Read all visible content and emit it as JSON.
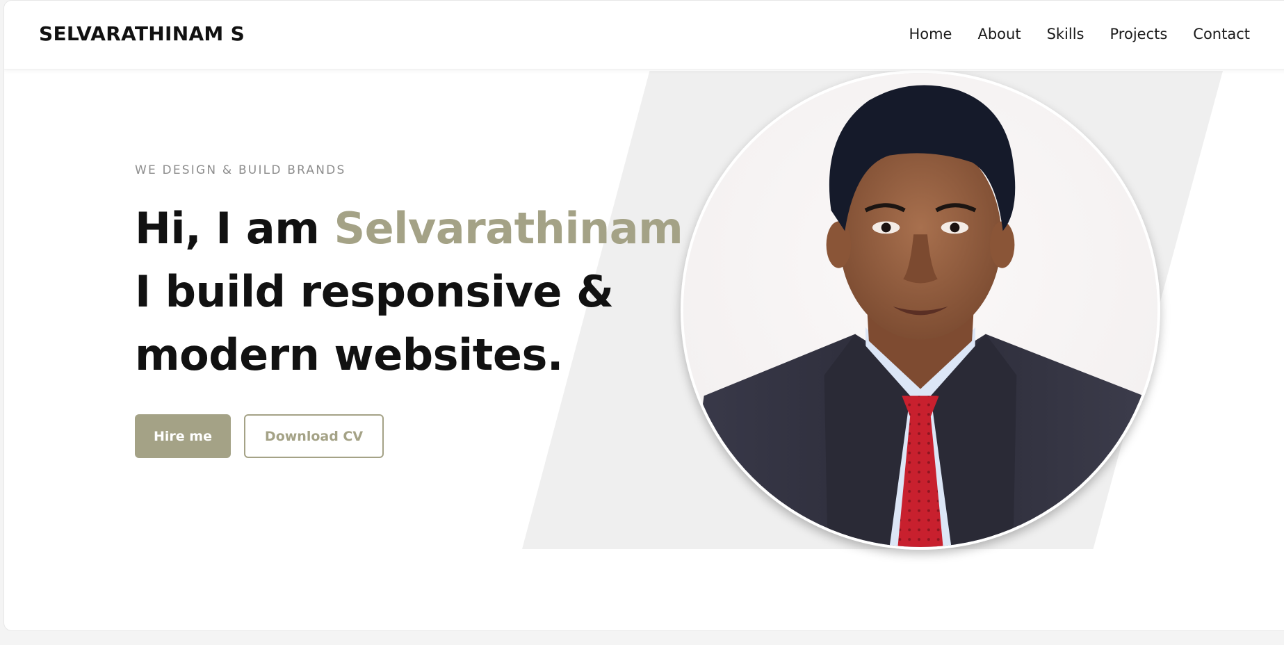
{
  "header": {
    "brand": "SELVARATHINAM S",
    "nav": [
      {
        "label": "Home"
      },
      {
        "label": "About"
      },
      {
        "label": "Skills"
      },
      {
        "label": "Projects"
      },
      {
        "label": "Contact"
      }
    ]
  },
  "hero": {
    "tagline": "WE DESIGN & BUILD BRANDS",
    "greeting_prefix": "Hi, I am ",
    "name": "Selvarathinam",
    "line2": "I build responsive &",
    "line3": "modern websites.",
    "hire_label": "Hire me",
    "cv_label": "Download CV"
  },
  "colors": {
    "accent": "#a4a286",
    "text": "#111111",
    "muted": "#8d8d8d",
    "panel": "#efefef"
  },
  "icons": {
    "profile": "profile-photo-portrait"
  }
}
